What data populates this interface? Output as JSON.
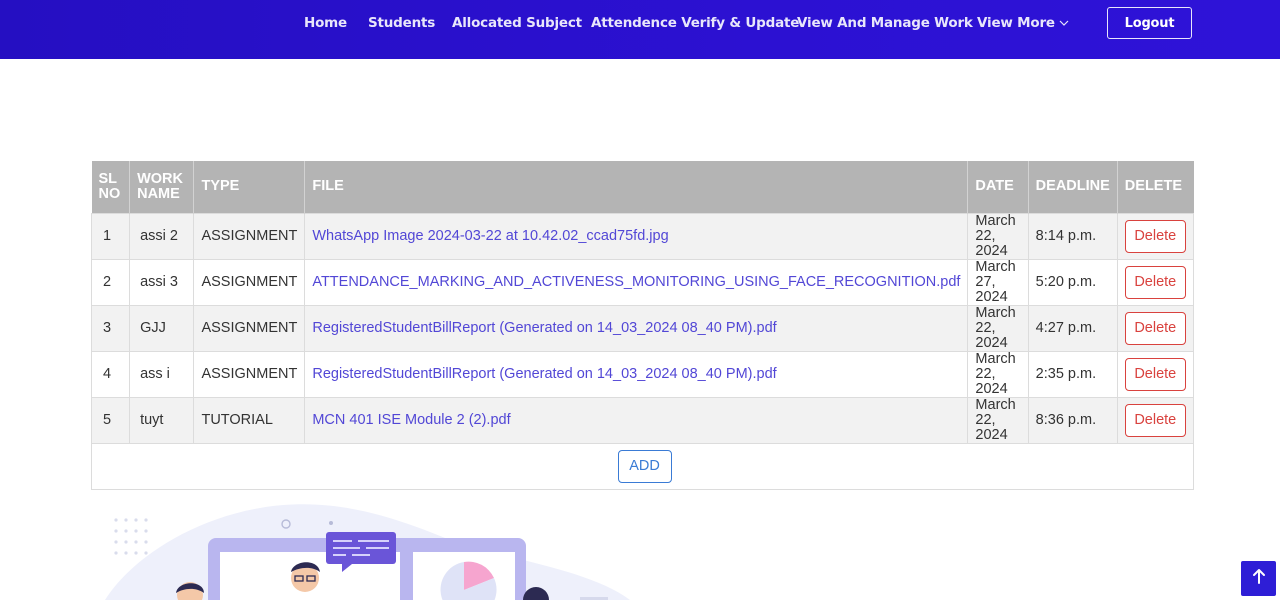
{
  "navbar": {
    "links": [
      {
        "label": "Home"
      },
      {
        "label": "Students"
      },
      {
        "label": "Allocated Subject"
      },
      {
        "label": "Attendence Verify & Update"
      },
      {
        "label": "View And Manage Work"
      },
      {
        "label": "View More"
      }
    ],
    "logout_label": "Logout",
    "color": "#2b0fcd"
  },
  "table": {
    "headers": {
      "sl": [
        "SL",
        "NO"
      ],
      "work": [
        "WORK",
        "NAME"
      ],
      "type": "TYPE",
      "file": "FILE",
      "date": "DATE",
      "deadline": "DEADLINE",
      "delete": "DELETE"
    },
    "rows": [
      {
        "sl": "1",
        "work_name": "assi 2",
        "type": "ASSIGNMENT",
        "file": "WhatsApp Image 2024-03-22 at 10.42.02_ccad75fd.jpg",
        "date": [
          "March 22,",
          "2024"
        ],
        "deadline": "8:14 p.m.",
        "delete_label": "Delete"
      },
      {
        "sl": "2",
        "work_name": "assi 3",
        "type": "ASSIGNMENT",
        "file": "ATTENDANCE_MARKING_AND_ACTIVENESS_MONITORING_USING_FACE_RECOGNITION.pdf",
        "date": [
          "March 27,",
          "2024"
        ],
        "deadline": "5:20 p.m.",
        "delete_label": "Delete"
      },
      {
        "sl": "3",
        "work_name": "GJJ",
        "type": "ASSIGNMENT",
        "file": "RegisteredStudentBillReport (Generated on 14_03_2024 08_40 PM).pdf",
        "date": [
          "March 22,",
          "2024"
        ],
        "deadline": "4:27 p.m.",
        "delete_label": "Delete"
      },
      {
        "sl": "4",
        "work_name": "ass i",
        "type": "ASSIGNMENT",
        "file": "RegisteredStudentBillReport (Generated on 14_03_2024 08_40 PM).pdf",
        "date": [
          "March 22,",
          "2024"
        ],
        "deadline": "2:35 p.m.",
        "delete_label": "Delete"
      },
      {
        "sl": "5",
        "work_name": "tuyt",
        "type": "TUTORIAL",
        "file": "MCN 401 ISE Module 2 (2).pdf",
        "date": [
          "March 22,",
          "2024"
        ],
        "deadline": "8:36 p.m.",
        "delete_label": "Delete"
      }
    ],
    "add_label": "ADD"
  },
  "icons": {
    "view_more": "chevron-down-icon",
    "scroll_top": "arrow-up-icon"
  },
  "colors": {
    "header_bg": "#b4b4b4",
    "link": "#5247d6",
    "delete": "#d9423e",
    "add": "#3a7bd5"
  }
}
